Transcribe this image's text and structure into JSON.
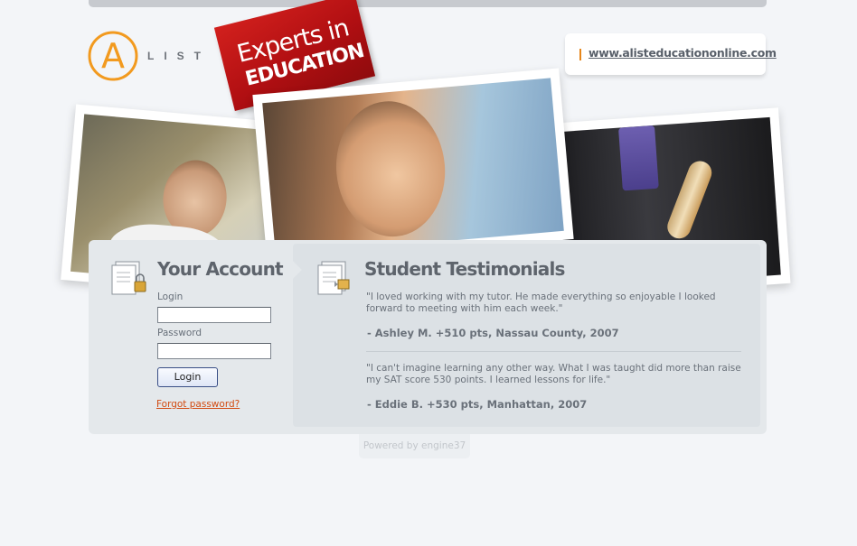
{
  "logo": {
    "letter": "A",
    "word": "LIST",
    "color": "#f29a1f"
  },
  "tag": {
    "line1": "Experts in",
    "line2": "EDUCATION",
    "color": "#c0161a"
  },
  "header": {
    "url": "www.alisteducationonline.com"
  },
  "account": {
    "title": "Your Account",
    "login_label": "Login",
    "password_label": "Password",
    "login_value": "",
    "password_value": "",
    "submit_label": "Login",
    "forgot_label": "Forgot password?"
  },
  "testimonials": {
    "title": "Student Testimonials",
    "items": [
      {
        "quote": "\"I loved working with my tutor.  He made everything so enjoyable I looked forward to meeting with him each week.\"",
        "author": "- Ashley M. +510 pts, Nassau County, 2007"
      },
      {
        "quote": "\"I can't imagine learning any other way. What I was taught did more than raise my SAT score 530 points. I learned lessons for life.\"",
        "author": "- Eddie B. +530 pts, Manhattan, 2007"
      }
    ]
  },
  "footer": {
    "powered": "Powered by engine37"
  }
}
